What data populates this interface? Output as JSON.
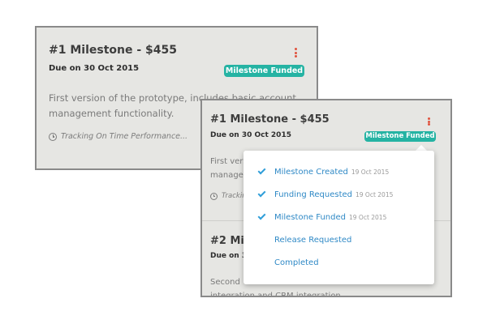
{
  "back_card": {
    "title": "#1 Milestone - $455",
    "due": "Due on 30 Oct 2015",
    "badge": "Milestone Funded",
    "description": "First version of the prototype, includes basic account management functionality.",
    "tracking": "Tracking On Time Performance..."
  },
  "front_card": {
    "milestone1": {
      "title": "#1 Milestone - $455",
      "due": "Due on 30 Oct 2015",
      "badge": "Milestone Funded",
      "description_partial": "First vers",
      "description_partial2": "manage",
      "tracking_partial": "Trackin"
    },
    "milestone2": {
      "title_partial": "#2 Mile",
      "due_partial": "Due on 31",
      "description_partial": "Second",
      "description_partial2": "integration and CRM integration."
    }
  },
  "status_dropdown": {
    "items": [
      {
        "label": "Milestone Created",
        "date": "19 Oct 2015",
        "checked": true
      },
      {
        "label": "Funding Requested",
        "date": "19 Oct 2015",
        "checked": true
      },
      {
        "label": "Milestone Funded",
        "date": "19 Oct 2015",
        "checked": true
      },
      {
        "label": "Release Requested",
        "date": "",
        "checked": false
      },
      {
        "label": "Completed",
        "date": "",
        "checked": false
      }
    ]
  },
  "colors": {
    "badge": "#25b3a3",
    "kebab": "#e0533f",
    "link": "#2f89c6",
    "check": "#2f9ed9"
  },
  "icons": [
    "kebab-menu-icon",
    "clock-icon",
    "check-icon"
  ]
}
